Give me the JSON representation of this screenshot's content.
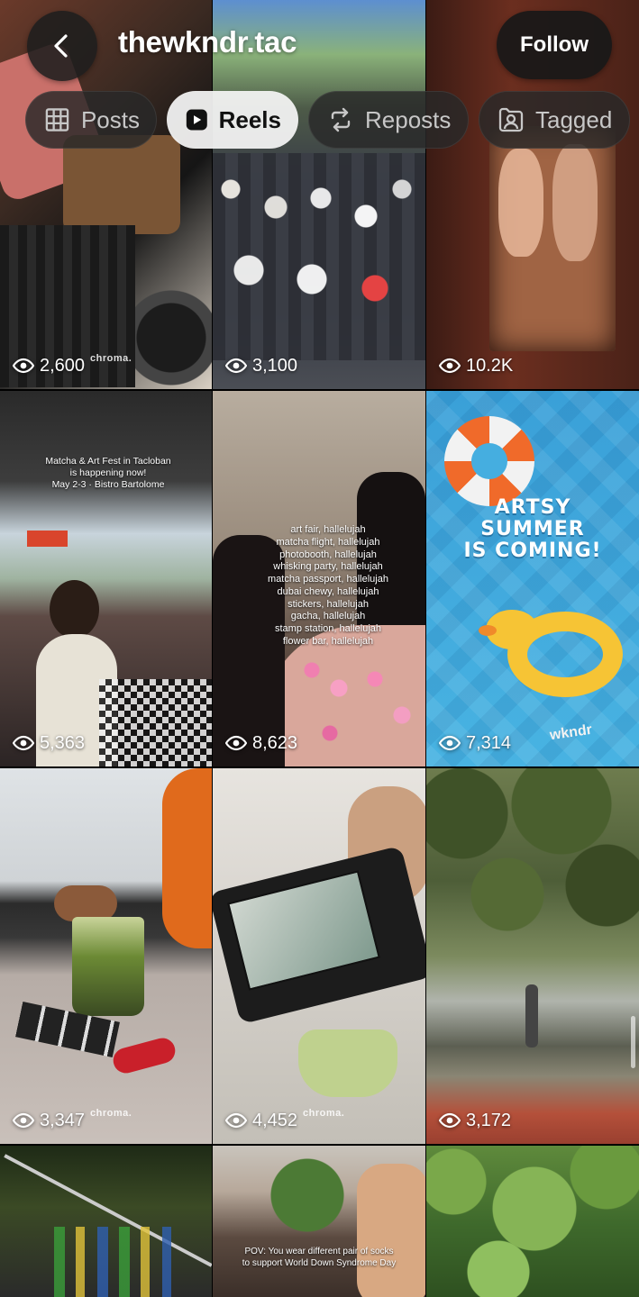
{
  "header": {
    "username": "thewkndr.tac",
    "follow_label": "Follow",
    "back_icon": "chevron-left-icon"
  },
  "tabs": [
    {
      "label": "Posts",
      "icon": "grid-icon",
      "active": false
    },
    {
      "label": "Reels",
      "icon": "reels-icon",
      "active": true
    },
    {
      "label": "Reposts",
      "icon": "repost-icon",
      "active": false
    },
    {
      "label": "Tagged",
      "icon": "tagged-person-icon",
      "active": false
    }
  ],
  "reels": [
    {
      "views": "2,600",
      "watermark": "chroma."
    },
    {
      "views": "3,100"
    },
    {
      "views": "10.2K"
    },
    {
      "views": "5,363",
      "overlay": "Matcha & Art Fest in Tacloban\nis happening now!\nMay 2-3 · Bistro Bartolome"
    },
    {
      "views": "8,623",
      "overlay": "art fair, hallelujah\nmatcha flight, hallelujah\nphotobooth, hallelujah\nwhisking party, hallelujah\nmatcha passport, hallelujah\ndubai chewy, hallelujah\nstickers, hallelujah\ngacha, hallelujah\nstamp station, hallelujah\nflower bar, hallelujah"
    },
    {
      "views": "7,314",
      "headline": "ARTSY\nSUMMER\nIS COMING!",
      "brand": "wkndr"
    },
    {
      "views": "3,347",
      "watermark": "chroma."
    },
    {
      "views": "4,452",
      "watermark": "chroma."
    },
    {
      "views": "3,172"
    },
    {
      "views": ""
    },
    {
      "views": "",
      "overlay": "POV: You wear different pair of socks\nto support World Down Syndrome Day"
    },
    {
      "views": ""
    }
  ],
  "colors": {
    "active_tab_bg": "#f5f5f5",
    "inactive_tab_bg": "#282828",
    "button_bg": "#181818"
  }
}
